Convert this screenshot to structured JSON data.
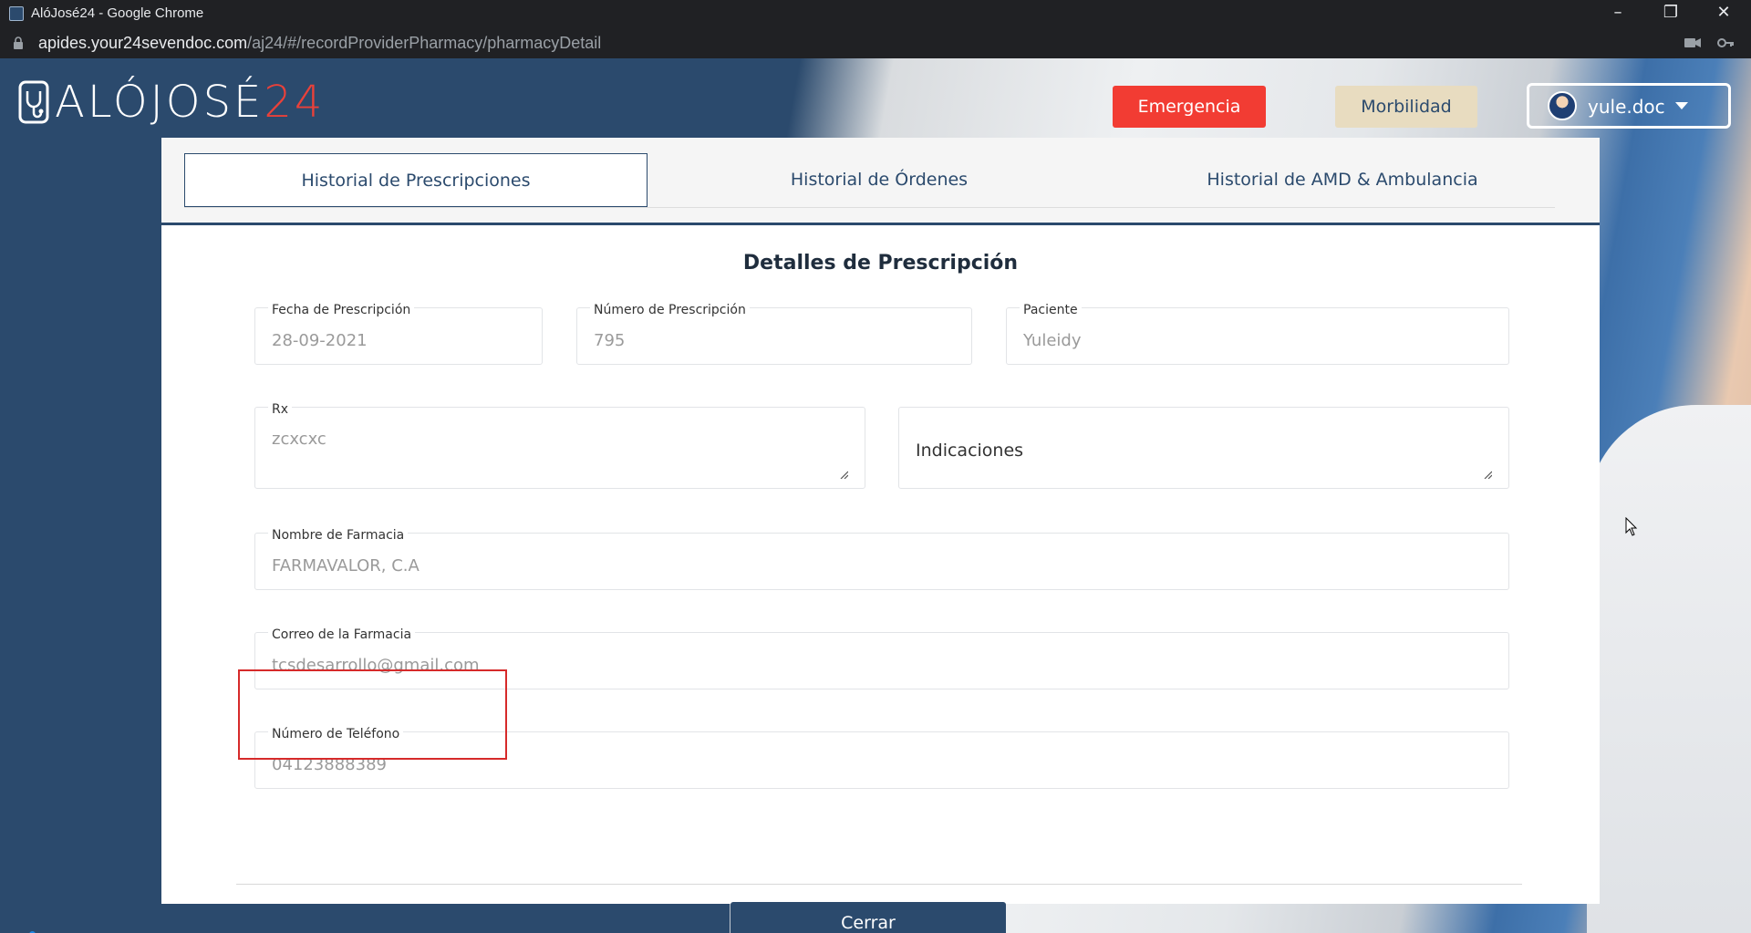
{
  "browser": {
    "window_title": "AlóJosé24 - Google Chrome",
    "url_host": "apides.your24sevendoc.com",
    "url_path": "/aj24/#/recordProviderPharmacy/pharmacyDetail"
  },
  "header": {
    "logo_main": "ALÓJOSÉ",
    "logo_accent": "24",
    "emergency_label": "Emergencia",
    "morbidity_label": "Morbilidad",
    "user_name": "yule.doc"
  },
  "tabs": [
    {
      "label": "Historial de Prescripciones",
      "active": true
    },
    {
      "label": "Historial de Órdenes",
      "active": false
    },
    {
      "label": "Historial de AMD & Ambulancia",
      "active": false
    }
  ],
  "form": {
    "title": "Detalles de Prescripción",
    "fecha_label": "Fecha de Prescripción",
    "fecha_value": "28-09-2021",
    "numero_label": "Número de Prescripción",
    "numero_value": "795",
    "paciente_label": "Paciente",
    "paciente_value": "Yuleidy",
    "rx_label": "Rx",
    "rx_value": "zcxcxc",
    "indicaciones_placeholder": "Indicaciones",
    "farmacia_label": "Nombre de Farmacia",
    "farmacia_value": "FARMAVALOR, C.A",
    "correo_label": "Correo de la Farmacia",
    "correo_value": "tcsdesarrollo@gmail.com",
    "telefono_label": "Número de Teléfono",
    "telefono_value": "04123888389",
    "close_label": "Cerrar"
  },
  "colors": {
    "primary": "#2b4a6d",
    "emergency": "#f23c33",
    "morbidity": "#e8dcc0",
    "highlight": "#d62a2a"
  }
}
